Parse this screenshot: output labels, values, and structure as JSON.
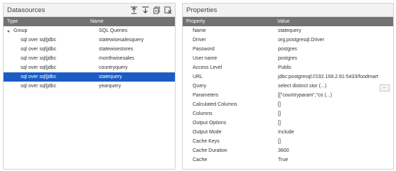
{
  "datasources": {
    "title": "Datasources",
    "columns": {
      "type": "Type",
      "name": "Name"
    },
    "toolbar": [
      {
        "icon": "upload-icon"
      },
      {
        "icon": "download-icon"
      },
      {
        "icon": "copy-icon"
      },
      {
        "icon": "delete-icon"
      }
    ],
    "group": {
      "type": "Group",
      "name": "SQL Queries"
    },
    "items": [
      {
        "type": "sql over sql|jdbc",
        "name": "statewisesalesquery"
      },
      {
        "type": "sql over sql|jdbc",
        "name": "statewisestores"
      },
      {
        "type": "sql over sql|jdbc",
        "name": "monthwisesales"
      },
      {
        "type": "sql over sql|jdbc",
        "name": "countryquery"
      },
      {
        "type": "sql over sql|jdbc",
        "name": "statequery",
        "selected": true
      },
      {
        "type": "sql over sql|jdbc",
        "name": "yearquery"
      }
    ],
    "selected_color": "#1a5cc4"
  },
  "properties": {
    "title": "Properties",
    "columns": {
      "property": "Property",
      "value": "Value"
    },
    "rows": [
      {
        "property": "Name",
        "value": "statequery"
      },
      {
        "property": "Driver",
        "value": "org.postgresql.Driver"
      },
      {
        "property": "Password",
        "value": "postgres"
      },
      {
        "property": "User name",
        "value": "postgres"
      },
      {
        "property": "Access Level",
        "value": "Public"
      },
      {
        "property": "URL",
        "value": "jdbc:postgresql://192.168.2.81:5433/foodmart"
      },
      {
        "property": "Query",
        "value": "select distinct stor (...)",
        "button": "..."
      },
      {
        "property": "Parameters",
        "value": "[[\"countryparam\",\"co (...)"
      },
      {
        "property": "Calculated Columns",
        "value": "[]"
      },
      {
        "property": "Columns",
        "value": "[]"
      },
      {
        "property": "Output Options",
        "value": "[]"
      },
      {
        "property": "Output Mode",
        "value": "Include"
      },
      {
        "property": "Cache Keys",
        "value": "[]"
      },
      {
        "property": "Cache Duration",
        "value": "3600"
      },
      {
        "property": "Cache",
        "value": "True"
      }
    ]
  },
  "colors": {
    "header_bar": "#727272",
    "panel_head": "#f2f2f2"
  }
}
